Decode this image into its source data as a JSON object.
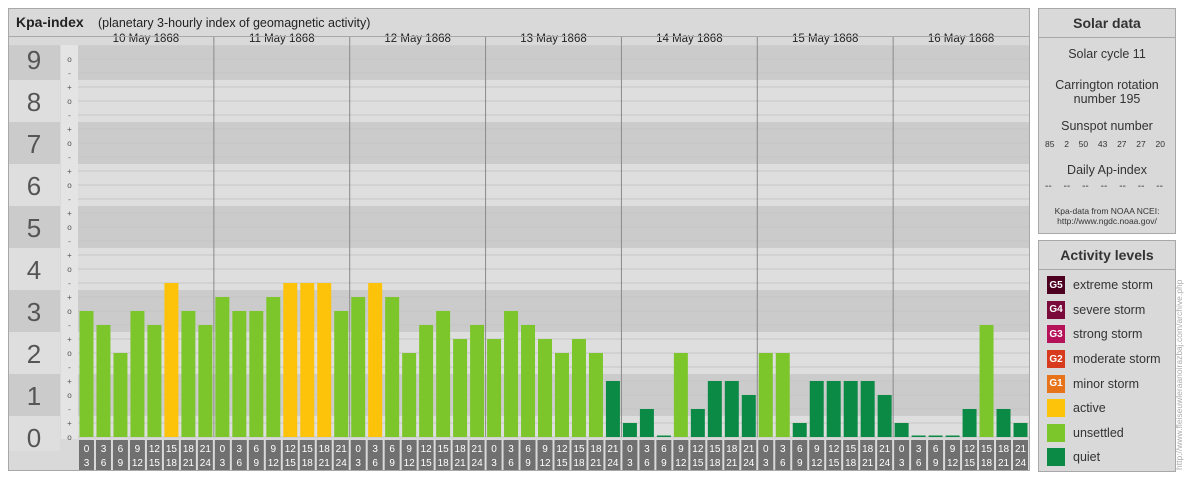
{
  "chart_data": {
    "type": "bar",
    "title": "Kpa-index",
    "subtitle": "(planetary 3-hourly index of geomagnetic activity)",
    "y_tick_labels": [
      "0",
      "1",
      "2",
      "3",
      "4",
      "5",
      "6",
      "7",
      "8",
      "9"
    ],
    "y_minor_labels": [
      "o",
      "+",
      "-"
    ],
    "ylim": [
      0,
      9.33
    ],
    "days": [
      "10 May 1868",
      "11 May 1868",
      "12 May 1868",
      "13 May 1868",
      "14 May 1868",
      "15 May 1868",
      "16 May 1868"
    ],
    "interval_start": [
      "0",
      "3",
      "6",
      "9",
      "12",
      "15",
      "18",
      "21"
    ],
    "interval_end": [
      "3",
      "6",
      "9",
      "12",
      "15",
      "18",
      "21",
      "24"
    ],
    "values": [
      3.0,
      2.667,
      2.0,
      3.0,
      2.667,
      3.667,
      3.0,
      2.667,
      3.333,
      3.0,
      3.0,
      3.333,
      3.667,
      3.667,
      3.667,
      3.0,
      3.333,
      3.667,
      3.333,
      2.0,
      2.667,
      3.0,
      2.333,
      2.667,
      2.333,
      3.0,
      2.667,
      2.333,
      2.0,
      2.333,
      2.0,
      1.333,
      0.333,
      0.667,
      0.0,
      2.0,
      0.667,
      1.333,
      1.333,
      1.0,
      2.0,
      2.0,
      0.333,
      1.333,
      1.333,
      1.333,
      1.333,
      1.0,
      0.333,
      0.0,
      0.0,
      0.0,
      0.667,
      2.667,
      0.667,
      0.333
    ],
    "level_colors": {
      "quiet": "#0a8a45",
      "unsettled": "#7cc62c",
      "active": "#fcc30a"
    },
    "grid": true
  },
  "solar_data": {
    "title": "Solar data",
    "solar_cycle": "Solar cycle 11",
    "carrington_line1": "Carrington rotation",
    "carrington_line2": "number 195",
    "sunspot_label": "Sunspot number",
    "sunspot_values": [
      "85",
      "2",
      "50",
      "43",
      "27",
      "27",
      "20"
    ],
    "ap_label": "Daily Ap-index",
    "ap_values": [
      "--",
      "--",
      "--",
      "--",
      "--",
      "--",
      "--"
    ],
    "source_line1": "Kpa-data from NOAA NCEI:",
    "source_line2": "http://www.ngdc.noaa.gov/"
  },
  "activity_levels": {
    "title": "Activity levels",
    "items": [
      {
        "badge": "G5",
        "label": "extreme storm",
        "color": "#4d0020"
      },
      {
        "badge": "G4",
        "label": "severe storm",
        "color": "#7a0a3c"
      },
      {
        "badge": "G3",
        "label": "strong storm",
        "color": "#b5125a"
      },
      {
        "badge": "G2",
        "label": "moderate storm",
        "color": "#d73a1c"
      },
      {
        "badge": "G1",
        "label": "minor storm",
        "color": "#e6731a"
      },
      {
        "badge": "",
        "label": "active",
        "color": "#fcc30a"
      },
      {
        "badge": "",
        "label": "unsettled",
        "color": "#7cc62c"
      },
      {
        "badge": "",
        "label": "quiet",
        "color": "#0a8a45"
      }
    ]
  },
  "watermark": "http://www.fleiseuwleraanoirazbaj.com/archive.php"
}
